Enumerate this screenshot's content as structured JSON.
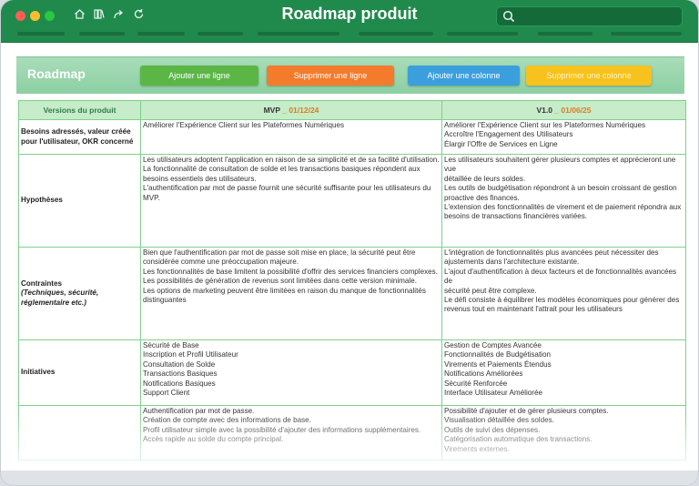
{
  "window": {
    "title": "Roadmap produit"
  },
  "ribbon": {
    "title": "Roadmap",
    "buttons": {
      "add_row": "Ajouter une ligne",
      "delete_row": "Supprimer une ligne",
      "add_column": "Ajouter une colonne",
      "delete_column": "Supprimer une colonne"
    }
  },
  "table": {
    "header": {
      "col0": "Versions du produit",
      "mvp_version": "MVP",
      "mvp_date": "01/12/24",
      "v1_version": "V1.0",
      "v1_date": "01/06/25"
    },
    "rows": [
      {
        "label": "Besoins adressés, valeur créée pour l'utilisateur, OKR concerné",
        "mvp": [
          "Améliorer l'Expérience Client sur les Plateformes Numériques"
        ],
        "v1": [
          "Améliorer l'Expérience Client sur les Plateformes Numériques",
          "Accroître l'Engagement des Utilisateurs",
          "Élargir l'Offre de Services en Ligne"
        ]
      },
      {
        "label": "Hypothèses",
        "mvp": [
          "Les utilisateurs adoptent l'application en raison de sa simplicité et de sa facilité d'utilisation.",
          "La fonctionnalité de consultation de solde et les transactions basiques répondent aux besoins essentiels des utilisateurs.",
          "L'authentification par mot de passe fournit une sécurité suffisante pour les utilisateurs du MVP."
        ],
        "v1": [
          "Les utilisateurs souhaitent gérer plusieurs comptes et apprécieront une vue",
          "détaillée de leurs soldes.",
          "Les outils de budgétisation répondront à un besoin croissant de gestion",
          "proactive des finances.",
          "L'extension des fonctionnalités de virement et de paiement répondra aux",
          "besoins de transactions financières variées."
        ]
      },
      {
        "label_main": "Contraintes",
        "label_sub": "(Techniques, sécurité, réglementaire etc.)",
        "mvp": [
          "Bien que l'authentification par mot de passe soit mise en place, la sécurité peut être considérée comme une préoccupation majeure.",
          "Les fonctionnalités de base limitent la possibilité d'offrir des services financiers complexes.",
          "Les possibilités de génération de revenus sont limitées dans cette version minimale.",
          "Les options de marketing peuvent être limitées en raison du manque de fonctionnalités distinguantes"
        ],
        "v1": [
          "L'intégration de fonctionnalités plus avancées peut nécessiter des",
          "ajustements dans l'architecture existante.",
          "L'ajout d'authentification à deux facteurs et de fonctionnalités avancées de",
          "sécurité peut être complexe.",
          "Le défi consiste à équilibrer les modèles économiques pour générer des",
          "revenus tout en maintenant l'attrait pour les utilisateurs"
        ]
      },
      {
        "label": "Initiatives",
        "mvp": [
          "Sécurité de Base",
          "Inscription et Profil Utilisateur",
          "Consultation de Solde",
          "Transactions Basiques",
          "Notifications Basiques",
          "Support Client"
        ],
        "v1": [
          "Gestion de Comptes Avancée",
          "Fonctionnalités de Budgétisation",
          "Virements et Paiements Étendus",
          "Notifications Améliorées",
          "Sécurité Renforcée",
          "Interface Utilisateur Améliorée"
        ]
      },
      {
        "label": "",
        "mvp": [
          "Authentification par mot de passe.",
          "Création de compte avec des informations de base.",
          "Profil utilisateur simple avec la possibilité d'ajouter des informations supplémentaires.",
          "Accès rapide au solde du compte principal."
        ],
        "v1": [
          "Possibilité d'ajouter et de gérer plusieurs comptes.",
          "Visualisation détaillée des soldes.",
          "Outils de suivi des dépenses.",
          "Catégorisation automatique des transactions.",
          "Virements externes."
        ]
      }
    ]
  }
}
